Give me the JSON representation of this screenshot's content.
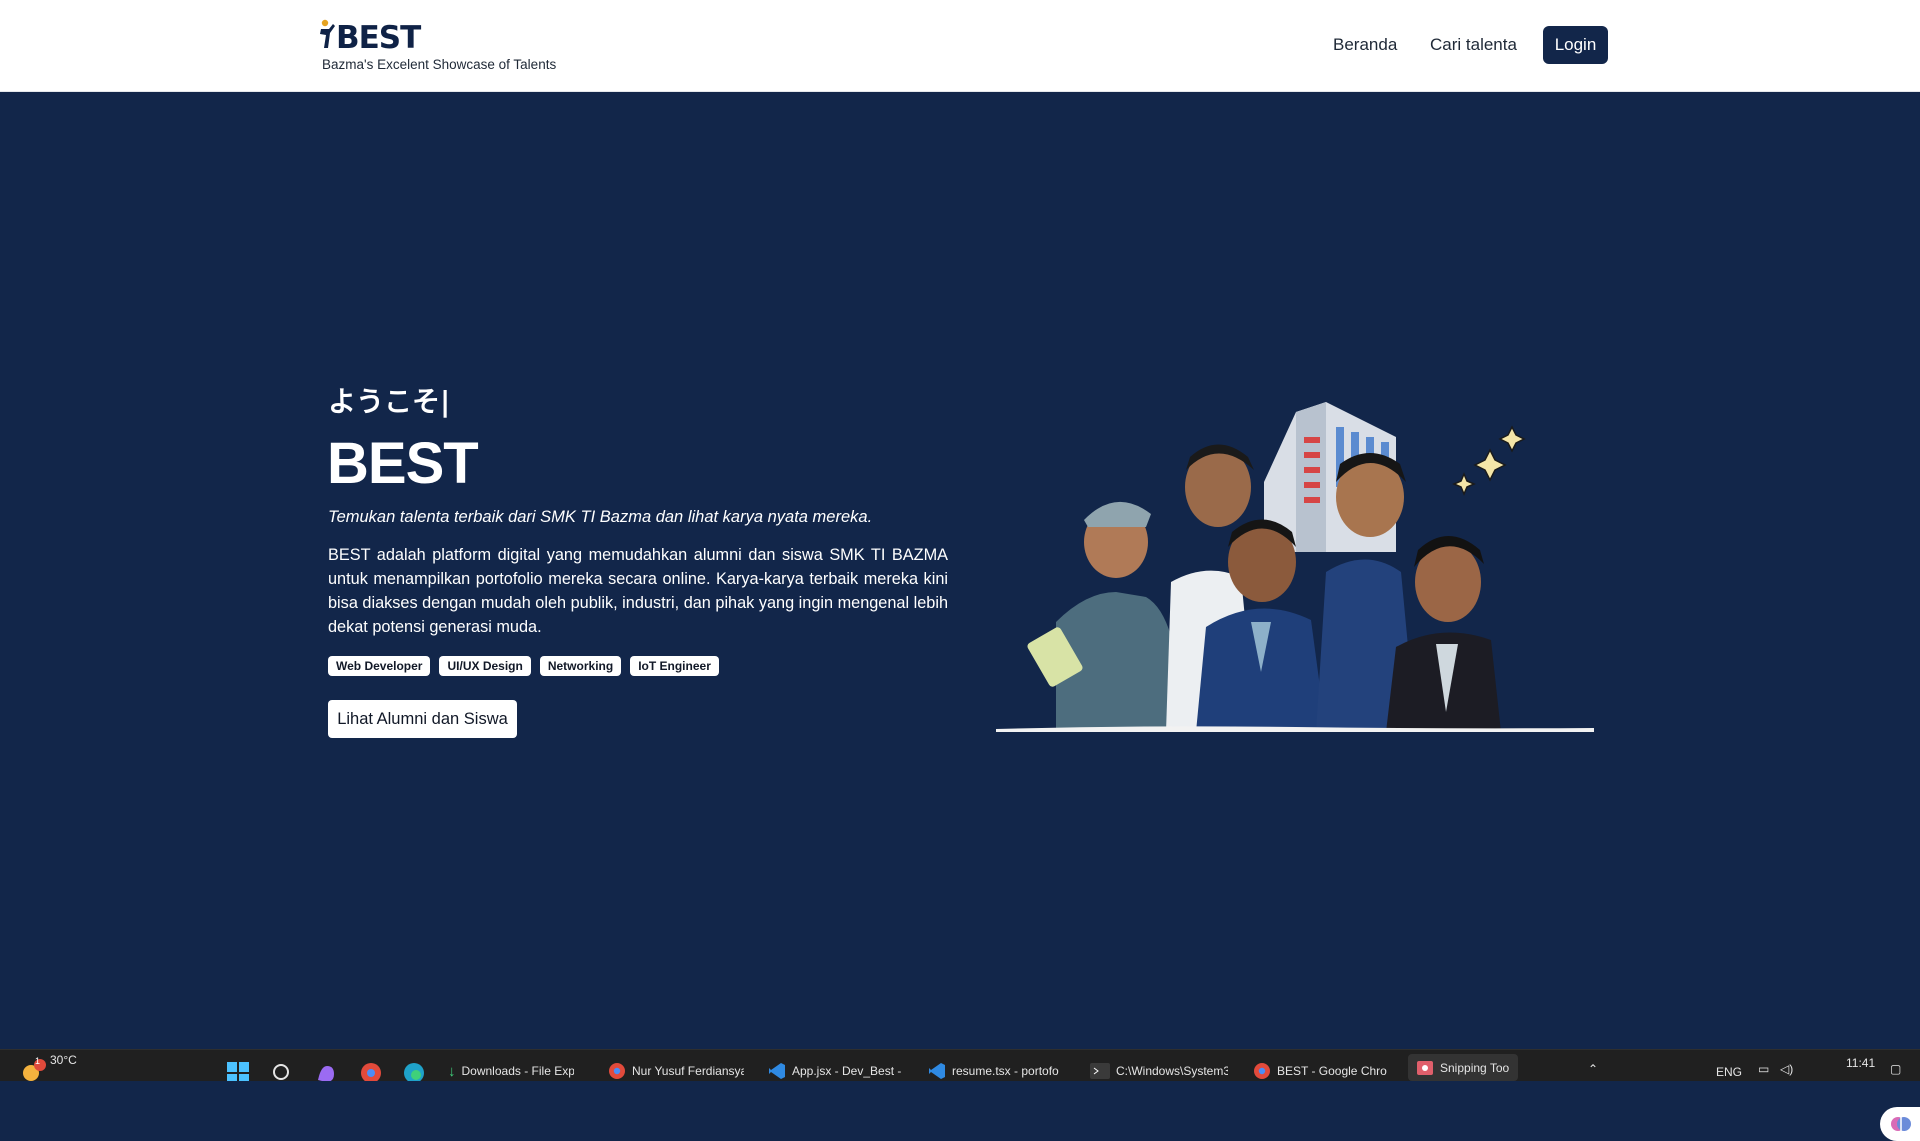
{
  "header": {
    "logo_text": "BEST",
    "tagline": "Bazma's Excelent Showcase of Talents",
    "nav": {
      "home": "Beranda",
      "search": "Cari talenta",
      "login": "Login"
    }
  },
  "hero": {
    "greeting": "ようこそ|",
    "title": "BEST",
    "subtitle": "Temukan talenta terbaik dari SMK TI Bazma dan lihat karya nyata mereka.",
    "description": "BEST adalah platform digital yang memudahkan alumni dan siswa SMK TI BAZMA untuk menampilkan portofolio mereka secara online. Karya-karya terbaik mereka kini bisa diakses dengan mudah oleh publik, industri, dan pihak yang ingin mengenal lebih dekat potensi generasi muda.",
    "tags": [
      "Web Developer",
      "UI/UX Design",
      "Networking",
      "IoT Engineer"
    ],
    "cta": "Lihat Alumni dan Siswa"
  },
  "taskbar": {
    "weather": {
      "temp": "30°C",
      "badge": "1"
    },
    "apps": [
      {
        "label": "Downloads - File Exp",
        "icon": "file-explorer-icon"
      },
      {
        "label": "Nur Yusuf Ferdiansya",
        "icon": "chrome-profile-icon"
      },
      {
        "label": "App.jsx - Dev_Best -",
        "icon": "vscode-icon"
      },
      {
        "label": "resume.tsx - portofo",
        "icon": "vscode-icon"
      },
      {
        "label": "C:\\Windows\\System3",
        "icon": "terminal-icon"
      },
      {
        "label": "BEST - Google Chro",
        "icon": "chrome-icon"
      },
      {
        "label": "Snipping Too",
        "icon": "snipping-tool-icon"
      }
    ],
    "tray": {
      "language": "ENG",
      "time": "11:41"
    }
  },
  "colors": {
    "navy": "#12264a",
    "white": "#ffffff"
  }
}
